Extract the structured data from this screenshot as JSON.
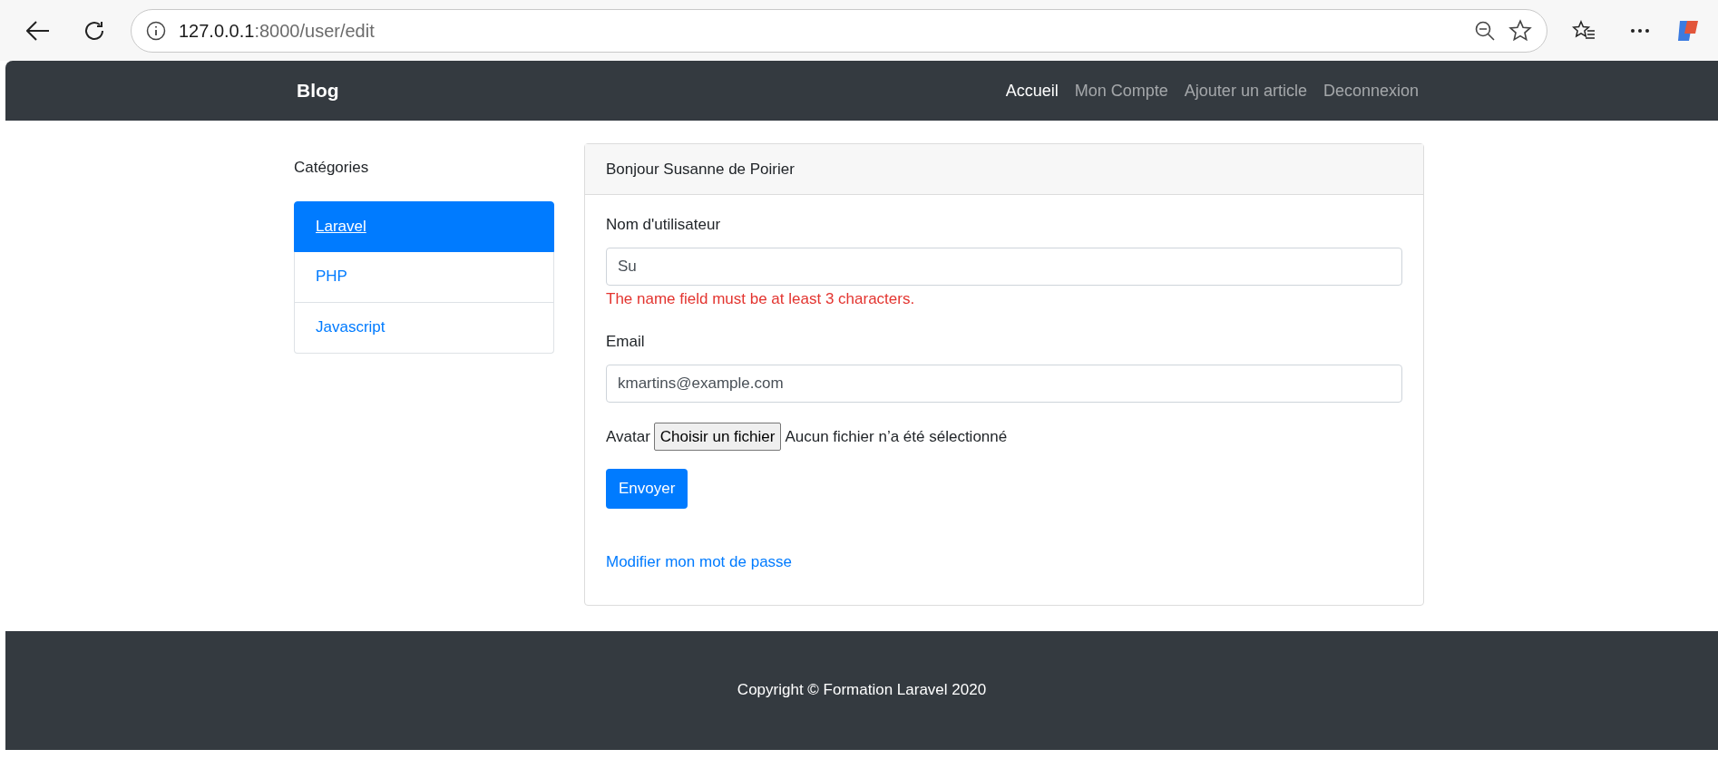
{
  "browser": {
    "url": {
      "host": "127.0.0.1",
      "path": ":8000/user/edit"
    }
  },
  "navbar": {
    "brand": "Blog",
    "links": [
      {
        "label": "Accueil",
        "selected": true
      },
      {
        "label": "Mon Compte",
        "selected": false
      },
      {
        "label": "Ajouter un article",
        "selected": false
      },
      {
        "label": "Deconnexion",
        "selected": false
      }
    ]
  },
  "sidebar": {
    "title": "Catégories",
    "items": [
      {
        "label": "Laravel",
        "selected": true
      },
      {
        "label": "PHP",
        "selected": false
      },
      {
        "label": "Javascript",
        "selected": false
      }
    ]
  },
  "card": {
    "header": "Bonjour Susanne de Poirier",
    "fields": [
      {
        "label": "Nom d'utilisateur",
        "value": "Su",
        "error": "The name field must be at least 3 characters."
      },
      {
        "label": "Email",
        "value": "kmartins@example.com"
      }
    ],
    "file": {
      "label": "Avatar",
      "button": "Choisir un fichier",
      "status": "Aucun fichier n’a été sélectionné"
    },
    "submit": "Envoyer",
    "link": "Modifier mon mot de passe"
  },
  "footer": {
    "text": "Copyright © Formation Laravel 2020"
  }
}
